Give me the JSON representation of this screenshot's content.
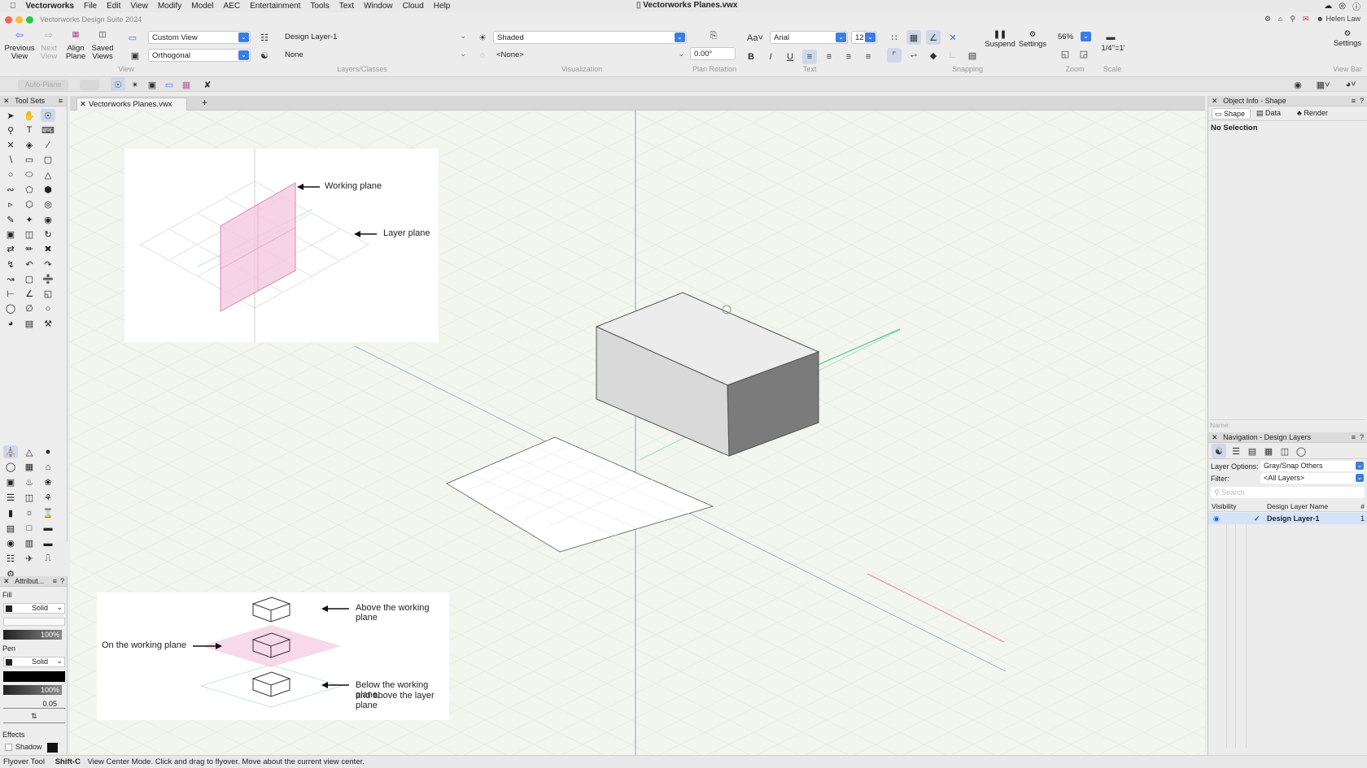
{
  "menubar": {
    "app": "Vectorworks",
    "items": [
      "File",
      "Edit",
      "View",
      "Modify",
      "Model",
      "AEC",
      "Entertainment",
      "Tools",
      "Text",
      "Window",
      "Cloud",
      "Help"
    ],
    "document_title": "Vectorworks Planes.vwx"
  },
  "window": {
    "app_title": "Vectorworks Design Suite 2024",
    "user": "Helen Law"
  },
  "toolbar": {
    "previous_view": "Previous View",
    "next_view": "Next View",
    "align_plane": "Align Plane",
    "saved_views": "Saved Views",
    "view_dropdown": "Custom View",
    "projection_dropdown": "Orthogonal",
    "layer_dropdown": "Design Layer-1",
    "class_dropdown": "None",
    "render_dropdown": "Shaded",
    "light_dropdown": "<None>",
    "plan_rotation_value": "0.00°",
    "font_dropdown": "Arial",
    "font_size": "12",
    "suspend": "Suspend",
    "settings": "Settings",
    "zoom_value": "56%",
    "scale_value": "1/4\"=1'",
    "settings_right": "Settings",
    "groups": {
      "view": "View",
      "layers_classes": "Layers/Classes",
      "visualization": "Visualization",
      "plan_rotation": "Plan Rotation",
      "text": "Text",
      "snapping": "Snapping",
      "zoom": "Zoom",
      "scale": "Scale",
      "view_bar": "View Bar"
    },
    "auto_plane": "Auto-Plane"
  },
  "toolsets": {
    "title": "Tool Sets"
  },
  "attributes": {
    "title": "Attribut...",
    "fill_label": "Fill",
    "fill_style": "Solid",
    "fill_opacity": "100%",
    "pen_label": "Pen",
    "pen_style": "Solid",
    "pen_opacity": "100%",
    "line_weight": "0.05",
    "effects_label": "Effects",
    "shadow_label": "Shadow"
  },
  "document_tab": {
    "name": "Vectorworks Planes.vwx",
    "add": "+"
  },
  "canvas": {
    "diagram1": {
      "working_plane": "Working plane",
      "layer_plane": "Layer plane"
    },
    "diagram2": {
      "above": "Above the working plane",
      "on": "On the working plane",
      "below_line1": "Below the working plane,",
      "below_line2": "and above the layer plane"
    }
  },
  "object_info": {
    "title": "Object Info - Shape",
    "tabs": [
      "Shape",
      "Data",
      "Render"
    ],
    "selection": "No Selection",
    "name_label": "Name:"
  },
  "navigation": {
    "title": "Navigation - Design Layers",
    "layer_options_label": "Layer Options:",
    "layer_options_value": "Gray/Snap Others",
    "filter_label": "Filter:",
    "filter_value": "<All Layers>",
    "search_placeholder": "Search",
    "col_visibility": "Visibility",
    "col_name": "Design Layer Name",
    "col_num": "#",
    "layers": [
      {
        "name": "Design Layer-1",
        "number": "1"
      }
    ]
  },
  "status": {
    "tool": "Flyover Tool",
    "shortcut": "Shift-C",
    "message": "View Center Mode. Click and drag to flyover.  Move about the current view center."
  }
}
